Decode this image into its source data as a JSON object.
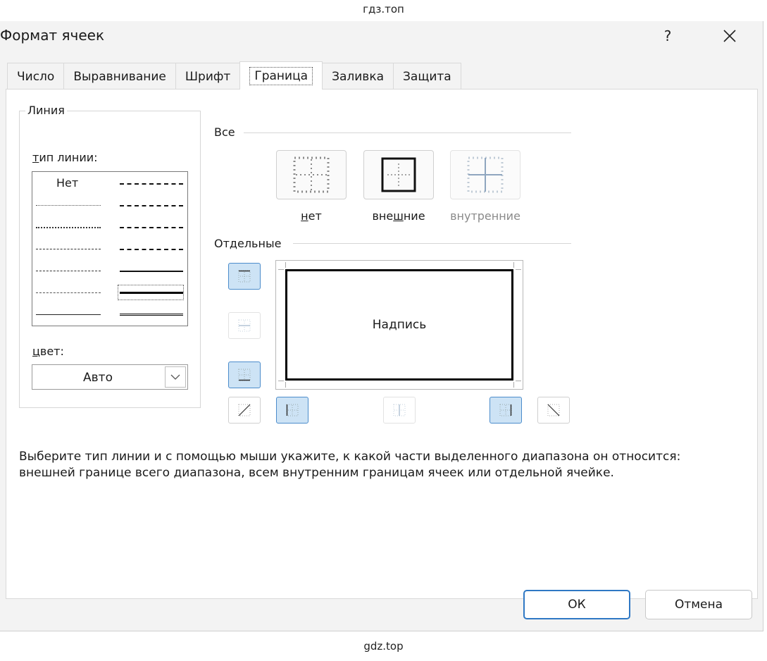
{
  "watermark_top": "гдз.топ",
  "watermark_bottom": "gdz.top",
  "dialog": {
    "title": "Формат ячеек",
    "help": "?",
    "close_icon": "close-icon"
  },
  "tabs": [
    {
      "label": "Число",
      "active": false
    },
    {
      "label": "Выравнивание",
      "active": false
    },
    {
      "label": "Шрифт",
      "active": false
    },
    {
      "label": "Граница",
      "active": true
    },
    {
      "label": "Заливка",
      "active": false
    },
    {
      "label": "Защита",
      "active": false
    }
  ],
  "line": {
    "legend": "Линия",
    "style_label_ul": "т",
    "style_label_rest": "ип линии:",
    "style_none": "Нет",
    "color_label_ul": "ц",
    "color_label_rest": "вет:",
    "color_value": "Авто"
  },
  "presets": {
    "legend": "Все",
    "none_ul": "н",
    "none_rest": "ет",
    "outline_pre": "вне",
    "outline_ul": "ш",
    "outline_post": "ние",
    "inside": "внутренние"
  },
  "border": {
    "legend": "Отдельные",
    "preview_text": "Надпись"
  },
  "hint": "Выберите тип линии и с помощью мыши укажите, к какой части выделенного диапазона он относится: внешней границе всего диапазона, всем внутренним границам ячеек или отдельной ячейке.",
  "buttons": {
    "ok": "ОК",
    "cancel": "Отмена"
  },
  "colors": {
    "accent": "#2f78c4",
    "toggle_on_bg": "#cde3f5",
    "toggle_on_border": "#4b8ccb"
  }
}
